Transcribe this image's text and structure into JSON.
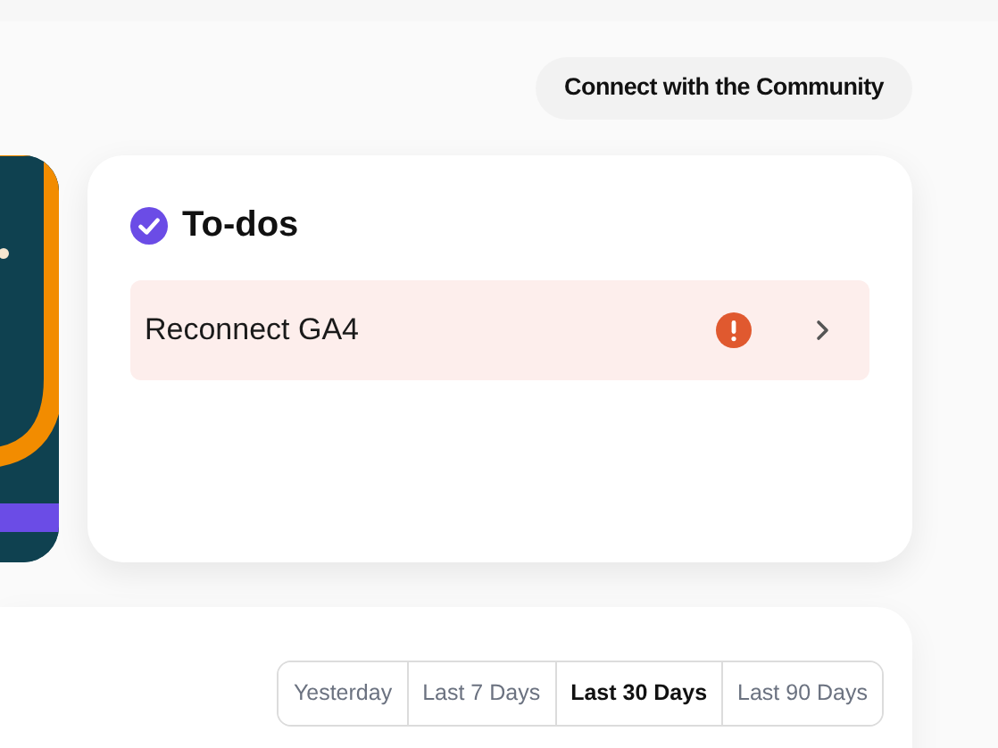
{
  "community_button": {
    "label": "Connect with the Community"
  },
  "todos": {
    "title": "To-dos",
    "items": [
      {
        "label": "Reconnect GA4",
        "alert": true
      }
    ]
  },
  "date_range": [
    {
      "label": "Yesterday",
      "selected": false
    },
    {
      "label": "Last 7 Days",
      "selected": false
    },
    {
      "label": "Last 30 Days",
      "selected": true
    },
    {
      "label": "Last 90 Days",
      "selected": false
    }
  ]
}
